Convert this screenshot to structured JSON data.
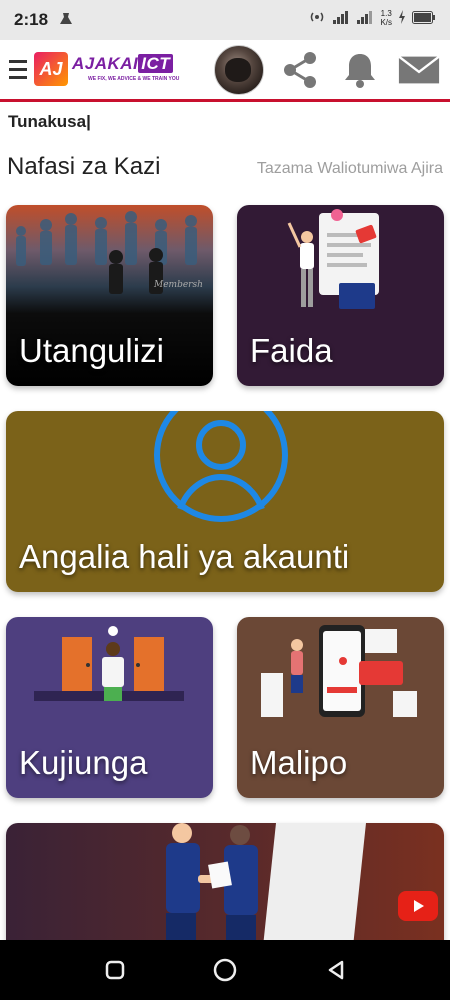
{
  "status_bar": {
    "time": "2:18",
    "net_speed_value": "1.3",
    "net_speed_unit": "K/s",
    "icons": [
      "notification-icon",
      "hotspot-icon",
      "signal-icon",
      "signal-icon",
      "charging-icon",
      "battery-icon"
    ]
  },
  "header": {
    "logo": {
      "mark": "AJ",
      "name_left": "AJAKAI",
      "name_right": "ICT",
      "tagline": "WE FIX, WE ADVICE & WE TRAIN YOU"
    },
    "icons": [
      "menu-icon",
      "share-icon",
      "bell-icon",
      "mail-icon"
    ],
    "accent_color": "#c8102e"
  },
  "search": {
    "text": "Tunakusa|"
  },
  "section": {
    "title": "Nafasi za Kazi",
    "link": "Tazama Waliotumiwa Ajira"
  },
  "cards": [
    {
      "label": "Utangulizi",
      "color": "#000000",
      "image_text": "Membersh"
    },
    {
      "label": "Faida",
      "color": "#321a35"
    },
    {
      "label": "Angalia hali ya akaunti",
      "color": "#7b6219",
      "icon": "user-icon"
    },
    {
      "label": "Kujiunga",
      "color": "#4e3f7f"
    },
    {
      "label": "Malipo",
      "color": "#6b4836"
    },
    {
      "label": "",
      "color": "#5a2a2a",
      "icon": "youtube-icon"
    }
  ],
  "nav": {
    "icons": [
      "recents-icon",
      "home-icon",
      "back-icon"
    ]
  }
}
